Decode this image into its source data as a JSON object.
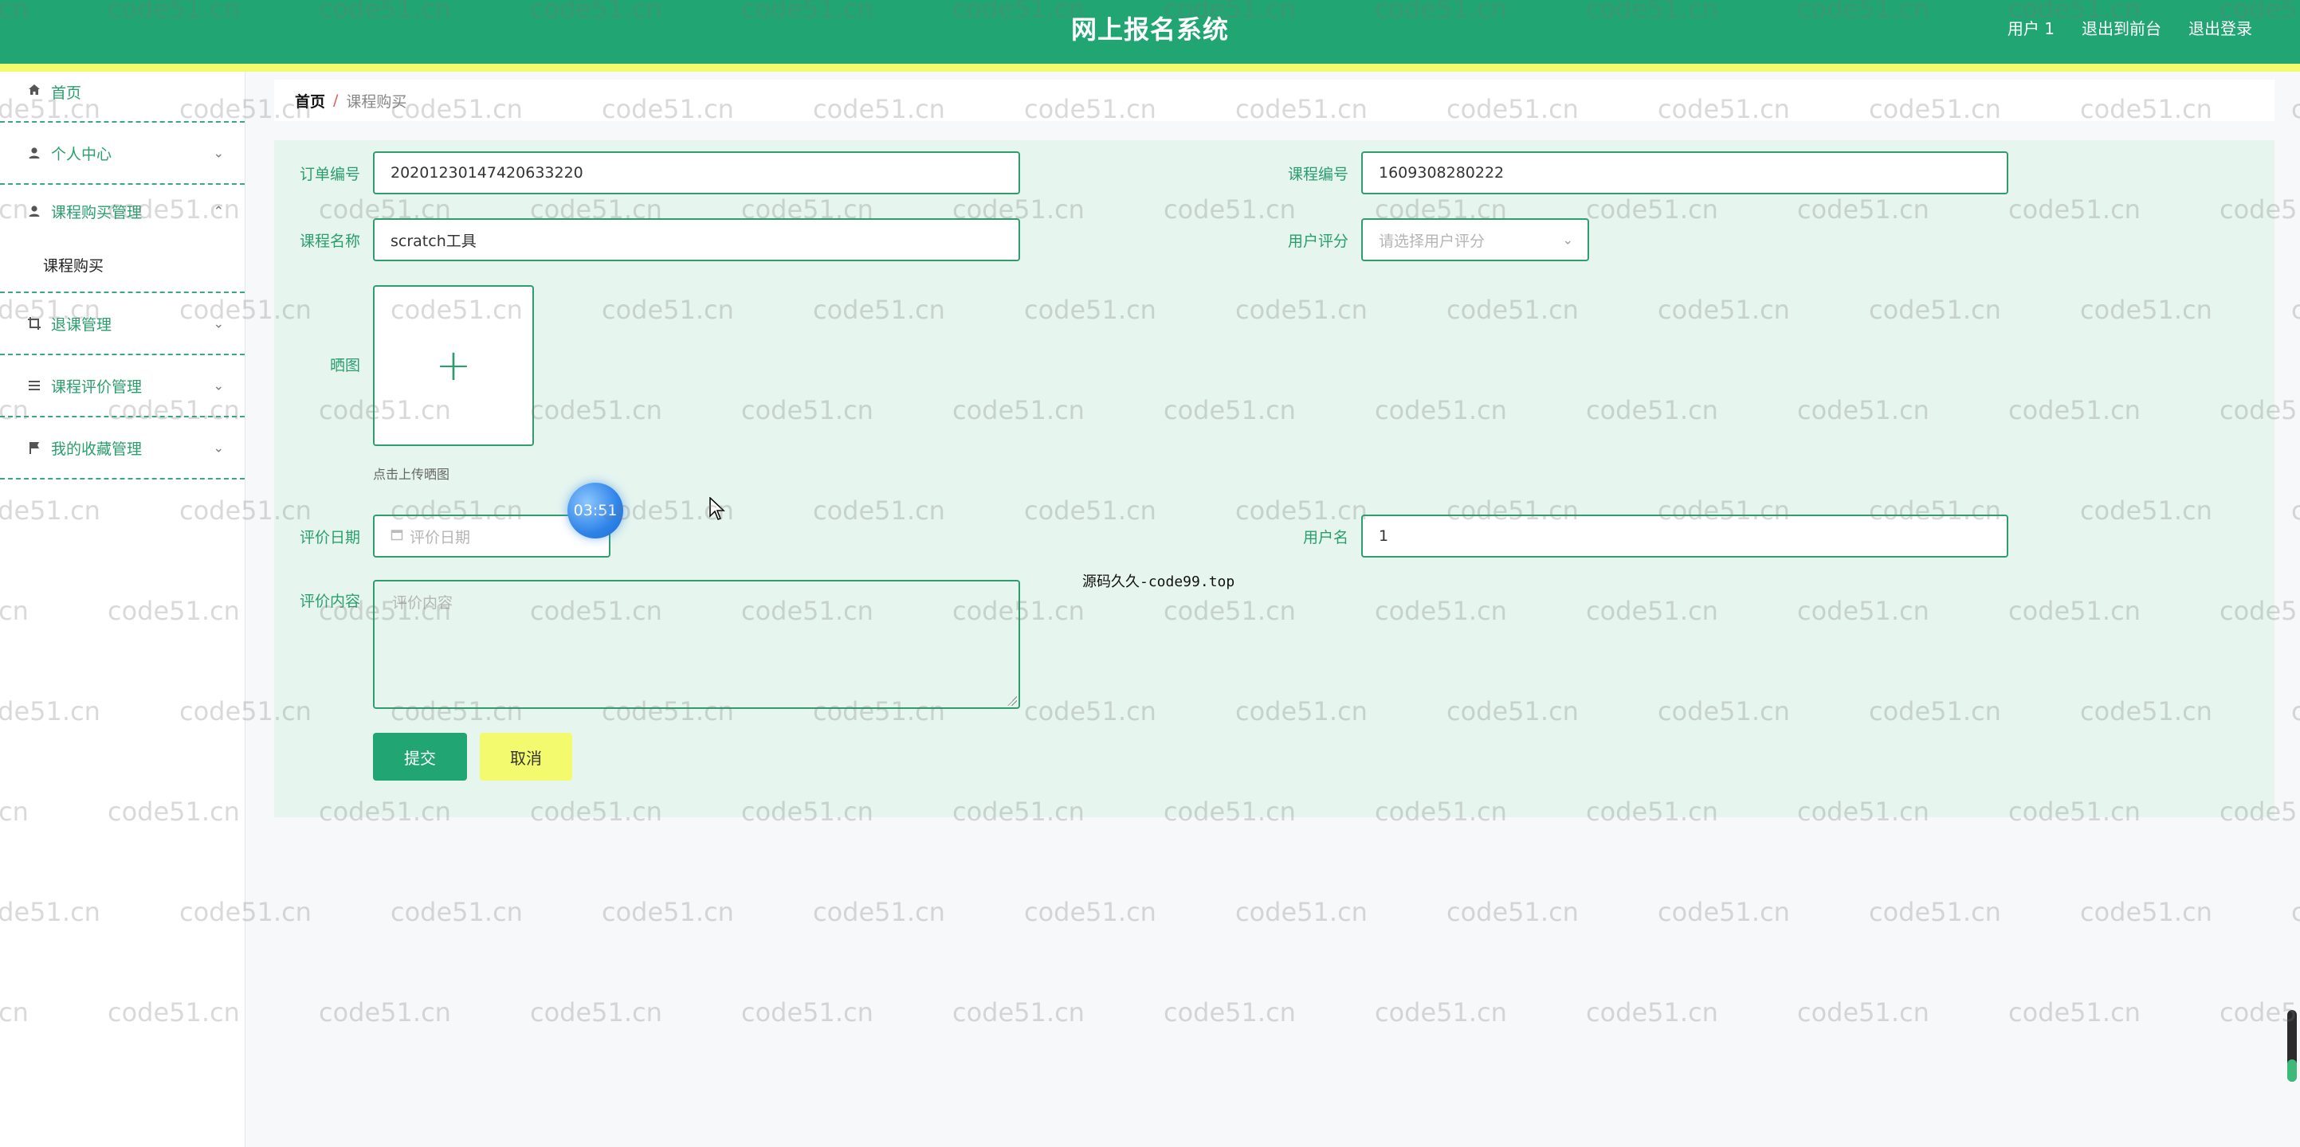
{
  "header": {
    "title": "网上报名系统",
    "user_label": "用户 1",
    "back_front_label": "退出到前台",
    "logout_label": "退出登录"
  },
  "sidebar": {
    "items": [
      {
        "label": "首页",
        "icon": "home-icon"
      },
      {
        "label": "个人中心",
        "icon": "user-icon"
      },
      {
        "label": "课程购买管理",
        "icon": "user-icon"
      },
      {
        "label": "退课管理",
        "icon": "crop-icon"
      },
      {
        "label": "课程评价管理",
        "icon": "list-icon"
      },
      {
        "label": "我的收藏管理",
        "icon": "flag-icon"
      }
    ],
    "submenu": {
      "label": "课程购买"
    }
  },
  "breadcrumb": {
    "home": "首页",
    "separator": "/",
    "current": "课程购买"
  },
  "form": {
    "order_no_label": "订单编号",
    "order_no_value": "20201230147420633220",
    "course_no_label": "课程编号",
    "course_no_value": "1609308280222",
    "course_name_label": "课程名称",
    "course_name_value": "scratch工具",
    "rating_label": "用户评分",
    "rating_placeholder": "请选择用户评分",
    "image_label": "晒图",
    "upload_hint": "点击上传晒图",
    "date_label": "评价日期",
    "date_placeholder": "评价日期",
    "username_label": "用户名",
    "username_value": "1",
    "content_label": "评价内容",
    "content_placeholder": "评价内容",
    "submit_label": "提交",
    "cancel_label": "取消"
  },
  "overlay": {
    "timer": "03:51",
    "source_text": "源码久久-code99.top",
    "watermark": "code51.cn"
  },
  "colors": {
    "primary": "#21a572",
    "accent_yellow": "#f4fa6d",
    "form_bg": "#e6f5ee"
  }
}
